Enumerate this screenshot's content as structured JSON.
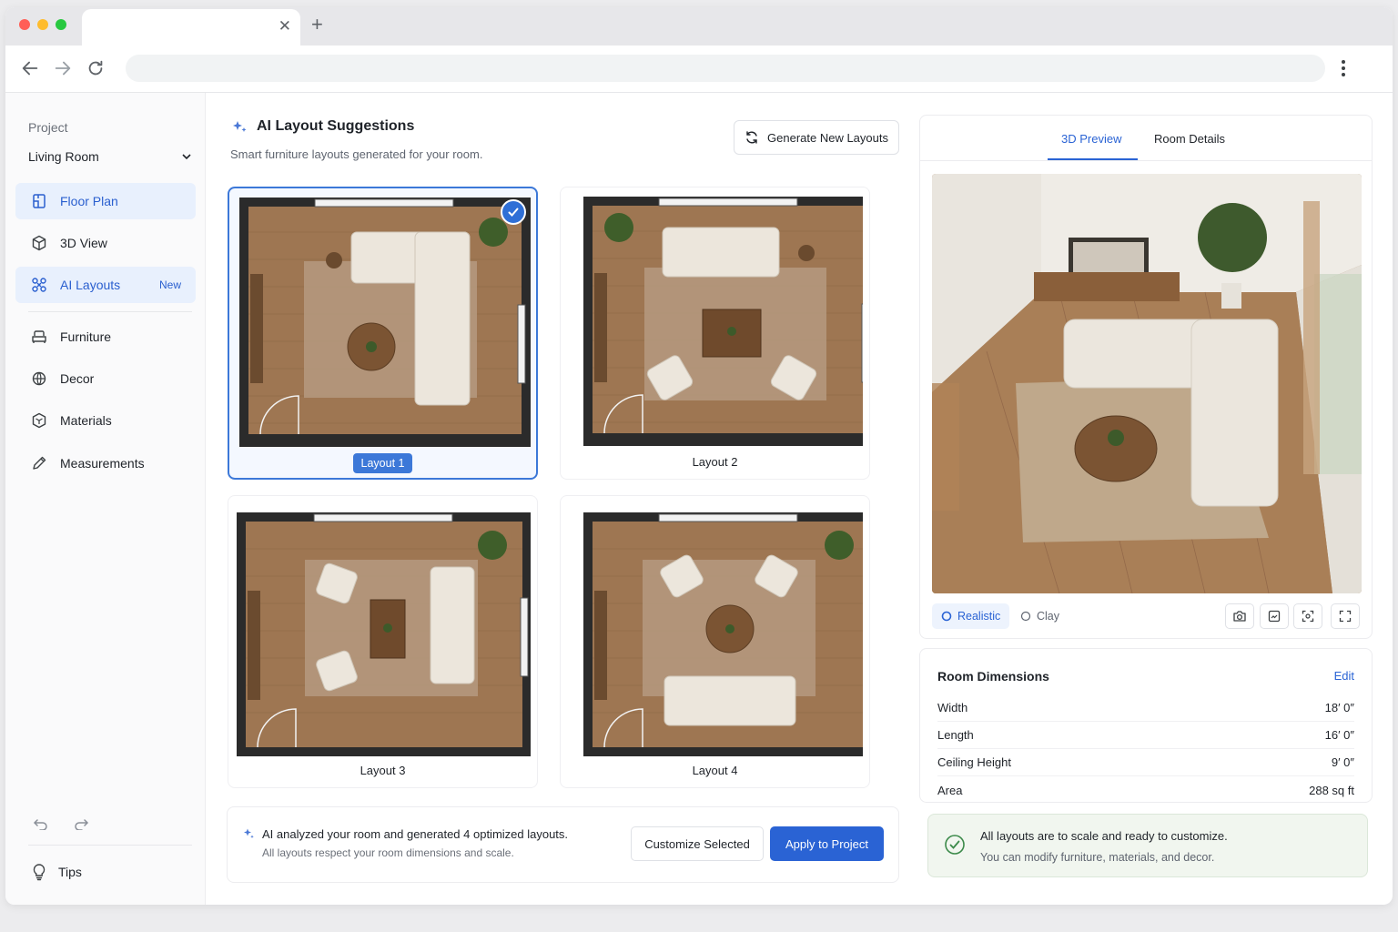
{
  "colors": {
    "accent": "#2a63d4",
    "selected_border": "#3c78d8",
    "success": "#3c8a4a"
  },
  "browser": {
    "url": ""
  },
  "sidebar": {
    "project_label": "Project",
    "project_value": "Living Room",
    "items": [
      {
        "label": "Floor Plan",
        "icon": "floor-plan-icon",
        "active": true
      },
      {
        "label": "3D View",
        "icon": "cube-icon"
      },
      {
        "label": "AI Layouts",
        "icon": "ai-layouts-icon",
        "badge": "New",
        "active": true
      },
      {
        "label": "Furniture",
        "icon": "armchair-icon"
      },
      {
        "label": "Decor",
        "icon": "decor-icon"
      },
      {
        "label": "Materials",
        "icon": "materials-icon"
      },
      {
        "label": "Measurements",
        "icon": "pencil-icon"
      }
    ],
    "tips_label": "Tips"
  },
  "main": {
    "title": "AI Layout Suggestions",
    "subtitle": "Smart furniture layouts generated for your room.",
    "generate_label": "Generate New Layouts",
    "layouts": [
      {
        "label": "Layout 1",
        "selected": true
      },
      {
        "label": "Layout 2",
        "selected": false
      },
      {
        "label": "Layout 3",
        "selected": false
      },
      {
        "label": "Layout 4",
        "selected": false
      }
    ],
    "info_title": "AI analyzed your room and generated 4 optimized layouts.",
    "info_sub": "All layouts respect your room dimensions and scale.",
    "customize_label": "Customize Selected",
    "apply_label": "Apply to Project"
  },
  "preview": {
    "tabs": [
      "3D Preview",
      "Room Details"
    ],
    "active_tab": "3D Preview",
    "modes": [
      "Realistic",
      "Clay"
    ],
    "active_mode": "Realistic",
    "controls": [
      "camera-icon",
      "snapshot-icon",
      "focus-icon",
      "fullscreen-icon"
    ]
  },
  "dimensions": {
    "title": "Room Dimensions",
    "edit_label": "Edit",
    "rows": [
      {
        "label": "Width",
        "value": "18′ 0″"
      },
      {
        "label": "Length",
        "value": "16′ 0″"
      },
      {
        "label": "Ceiling Height",
        "value": "9′ 0″"
      },
      {
        "label": "Area",
        "value": "288 sq ft"
      }
    ]
  },
  "note": {
    "title": "All layouts are to scale and ready to customize.",
    "sub": "You can modify furniture, materials, and decor."
  }
}
